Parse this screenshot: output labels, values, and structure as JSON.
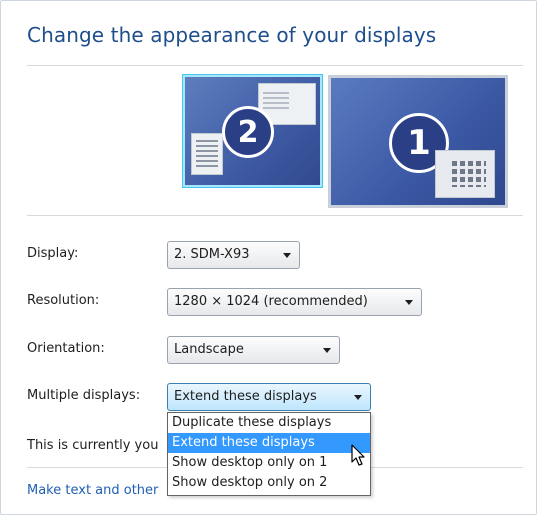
{
  "title": "Change the appearance of your displays",
  "monitors": [
    {
      "number": "2",
      "selected": true
    },
    {
      "number": "1",
      "selected": false
    }
  ],
  "settings": {
    "display": {
      "label": "Display:",
      "value": "2. SDM-X93"
    },
    "resolution": {
      "label": "Resolution:",
      "value": "1280 × 1024 (recommended)"
    },
    "orientation": {
      "label": "Orientation:",
      "value": "Landscape"
    },
    "multiple": {
      "label": "Multiple displays:",
      "value": "Extend these displays",
      "options": [
        "Duplicate these displays",
        "Extend these displays",
        "Show desktop only on 1",
        "Show desktop only on 2"
      ],
      "highlighted_index": 1
    }
  },
  "status_text": "This is currently you",
  "link_text": "Make text and other",
  "colors": {
    "title": "#1e4e8c",
    "link": "#1f5fb3",
    "selection": "#3399ff",
    "monitor_blue": "#3e5aa3",
    "selected_monitor_border": "#43c8f0"
  }
}
